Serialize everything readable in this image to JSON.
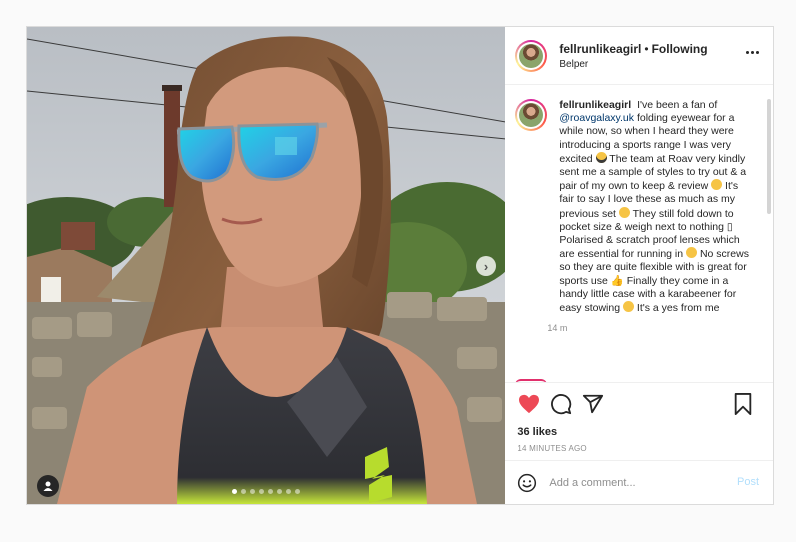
{
  "post": {
    "username": "fellrunlikeagirl",
    "bullet": "•",
    "follow_status": "Following",
    "location": "Belper",
    "caption": {
      "username": "fellrunlikeagirl",
      "p1": "I've been a fan of",
      "mention": "@roavgalaxy.uk",
      "p2": "folding eyewear for a while now, so when I heard they were introducing a sports range I was very excited",
      "p3": "The team at Roav very kindly sent me a sample of styles to try out & a pair of my own to keep & review",
      "p4": "It's fair to say I love these as much as my previous set",
      "p5": "They still fold down to pocket size & weigh next to nothing",
      "p6": "Polarised & scratch proof lenses which are essential for running in",
      "p7": "No screws so they are quite flexible with is great for sports use",
      "p8": "Finally they come in a handy little case with a karabeener for easy stowing",
      "p9": "It's a yes from me",
      "box_char": "▯"
    },
    "caption_time": "14 m",
    "likes": "36 likes",
    "time_ago": "14 MINUTES AGO",
    "comment_placeholder": "Add a comment...",
    "post_label": "Post",
    "carousel": {
      "total": 8,
      "active_index": 0
    }
  },
  "icons": {
    "next": "chevron-right-icon",
    "more": "more-options-icon",
    "like": "heart-filled-icon",
    "comment": "comment-icon",
    "share": "share-plane-icon",
    "save": "bookmark-icon",
    "emoji": "smiley-icon",
    "tag": "user-tag-icon"
  },
  "colors": {
    "like_red": "#ed4956",
    "mention_blue": "#00376b",
    "post_disabled": "#b2dffc",
    "muted": "#8e8e8e"
  }
}
